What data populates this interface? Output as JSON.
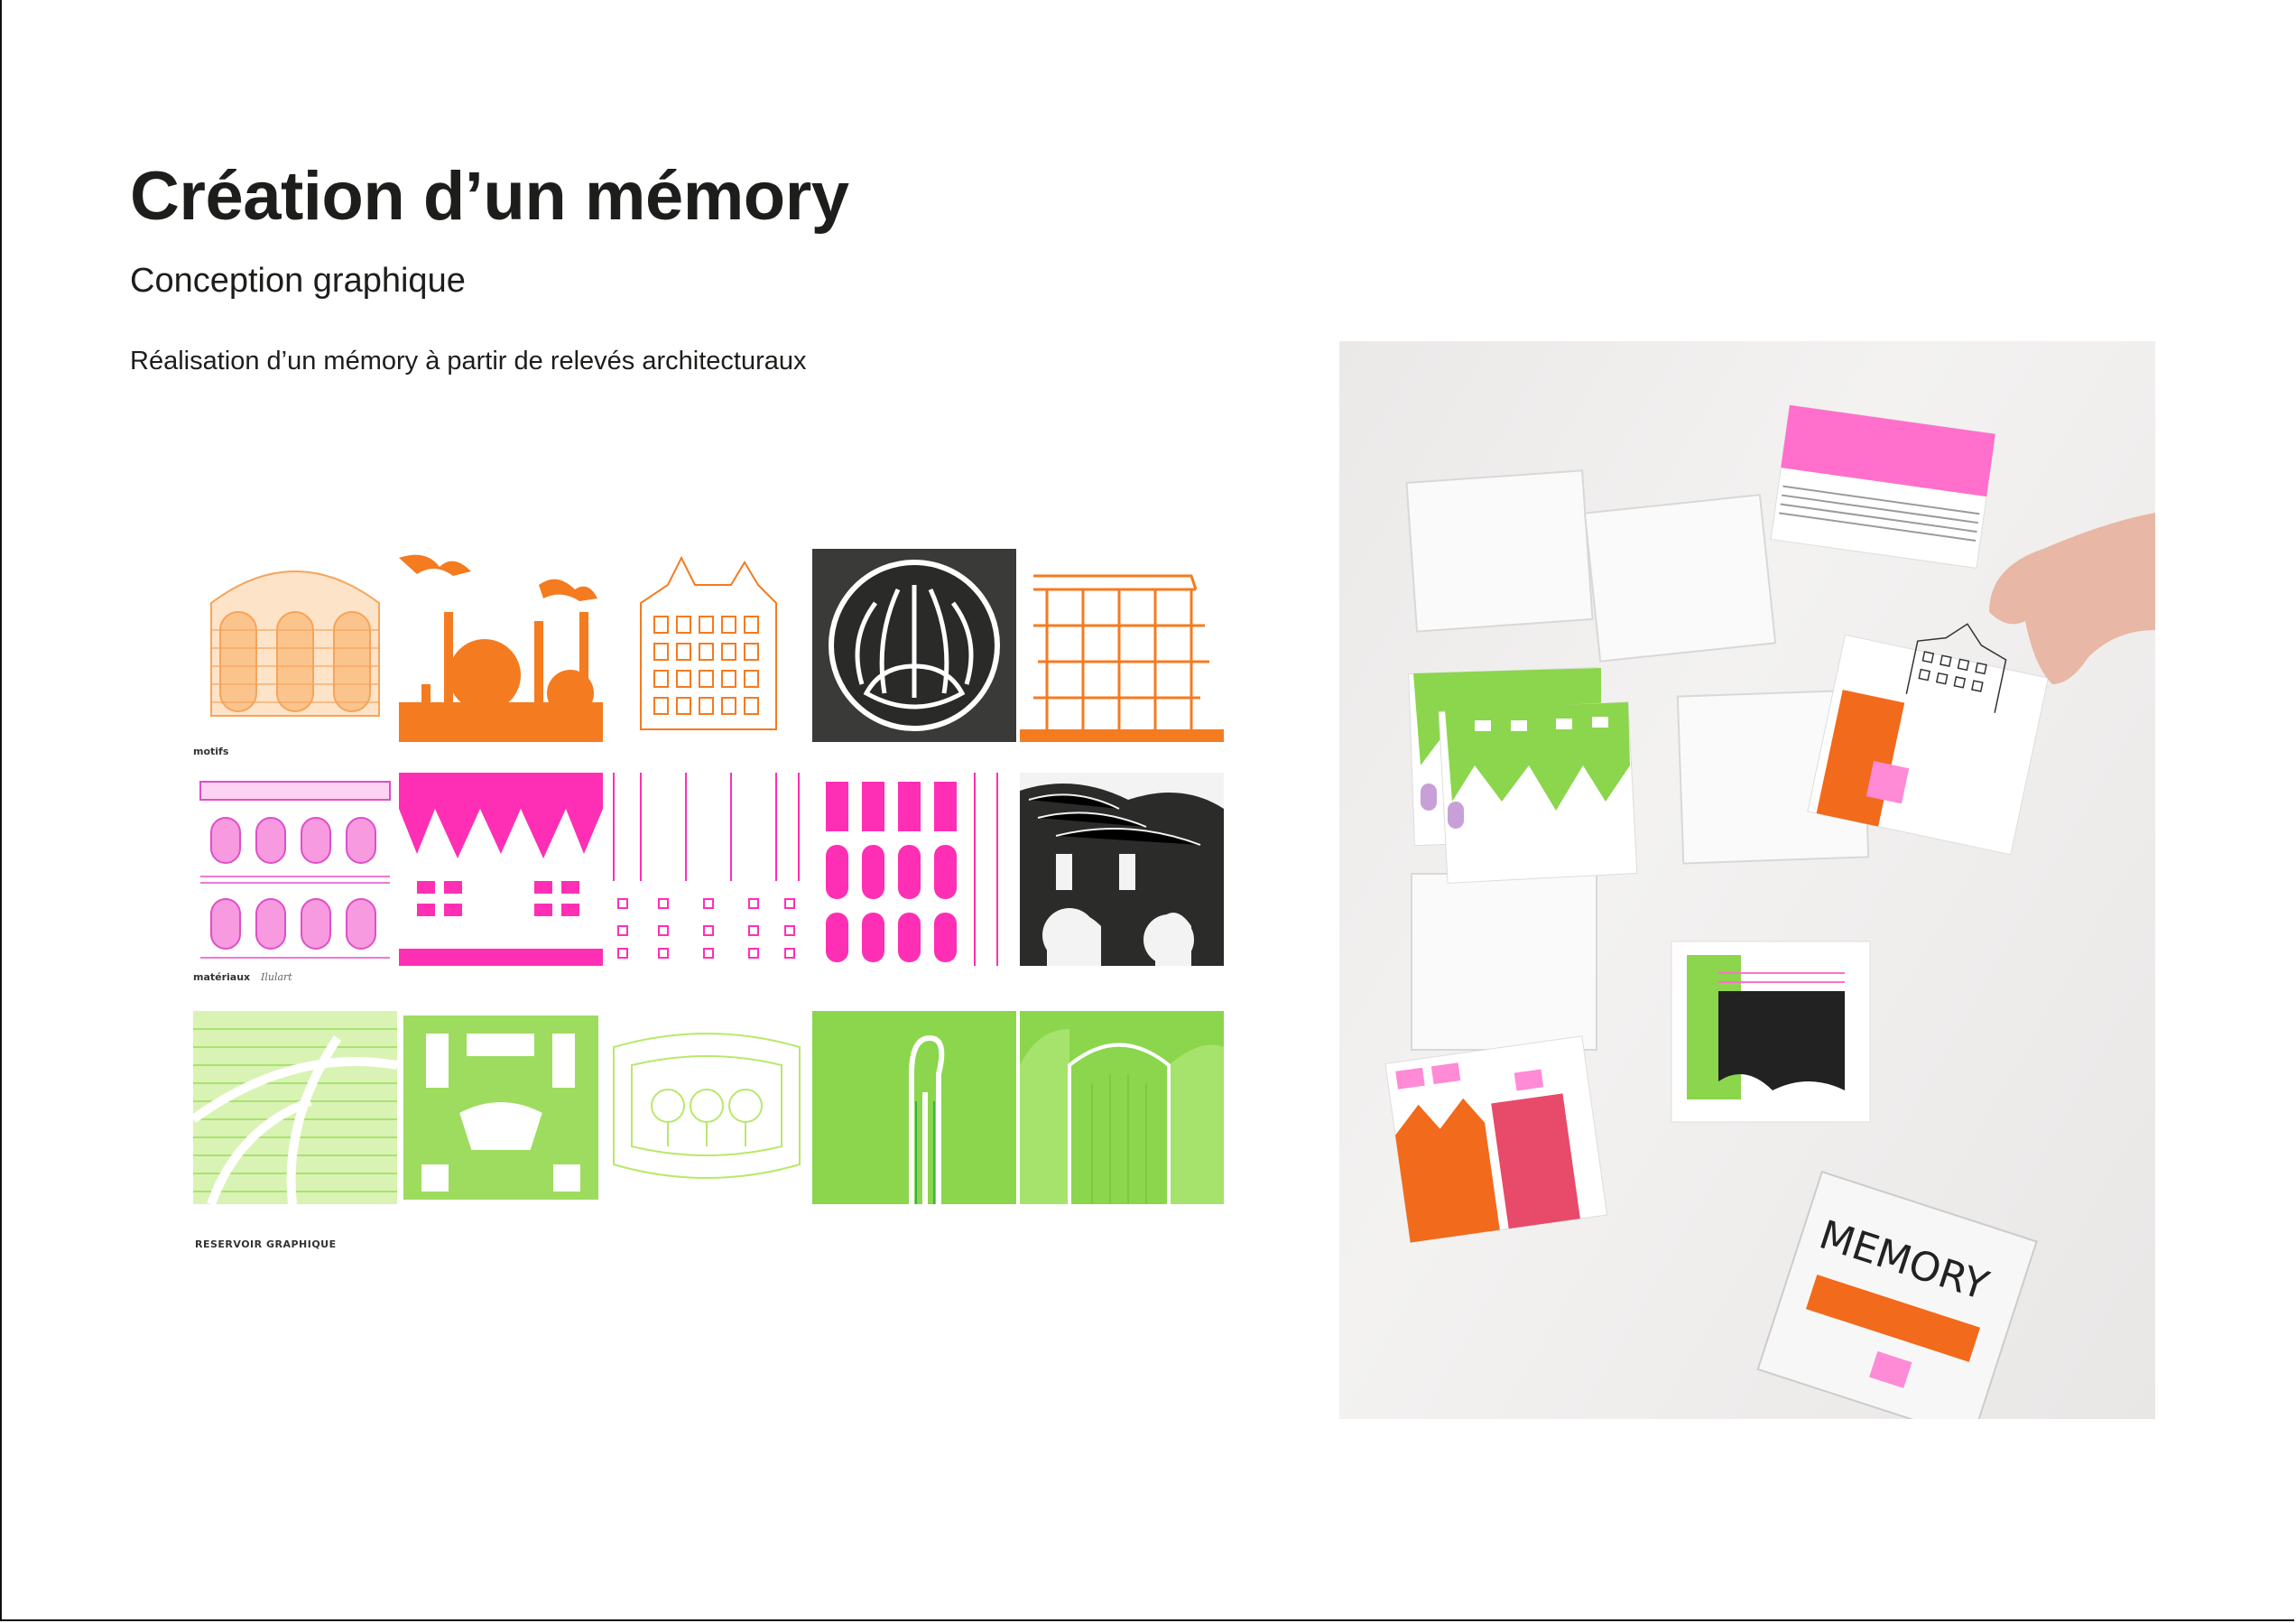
{
  "title": "Création d’un mémory",
  "subtitle": "Conception graphique",
  "description": "Réalisation d’un mémory à partir de relevés architecturaux",
  "board": {
    "rows": [
      {
        "label": "motifs",
        "handwritten": "",
        "color": "#f47b20"
      },
      {
        "label": "matériaux",
        "handwritten": "Ilulart",
        "color": "#ff2fb5"
      },
      {
        "label": "",
        "handwritten": "",
        "color": "#8fd94a"
      }
    ],
    "caption": "RESERVOIR GRAPHIQUE"
  },
  "photo": {
    "box_text": "MEMORY",
    "colors": {
      "orange": "#f26a1b",
      "pink": "#ff3fb0",
      "green": "#8bd64c",
      "black": "#222222"
    }
  }
}
